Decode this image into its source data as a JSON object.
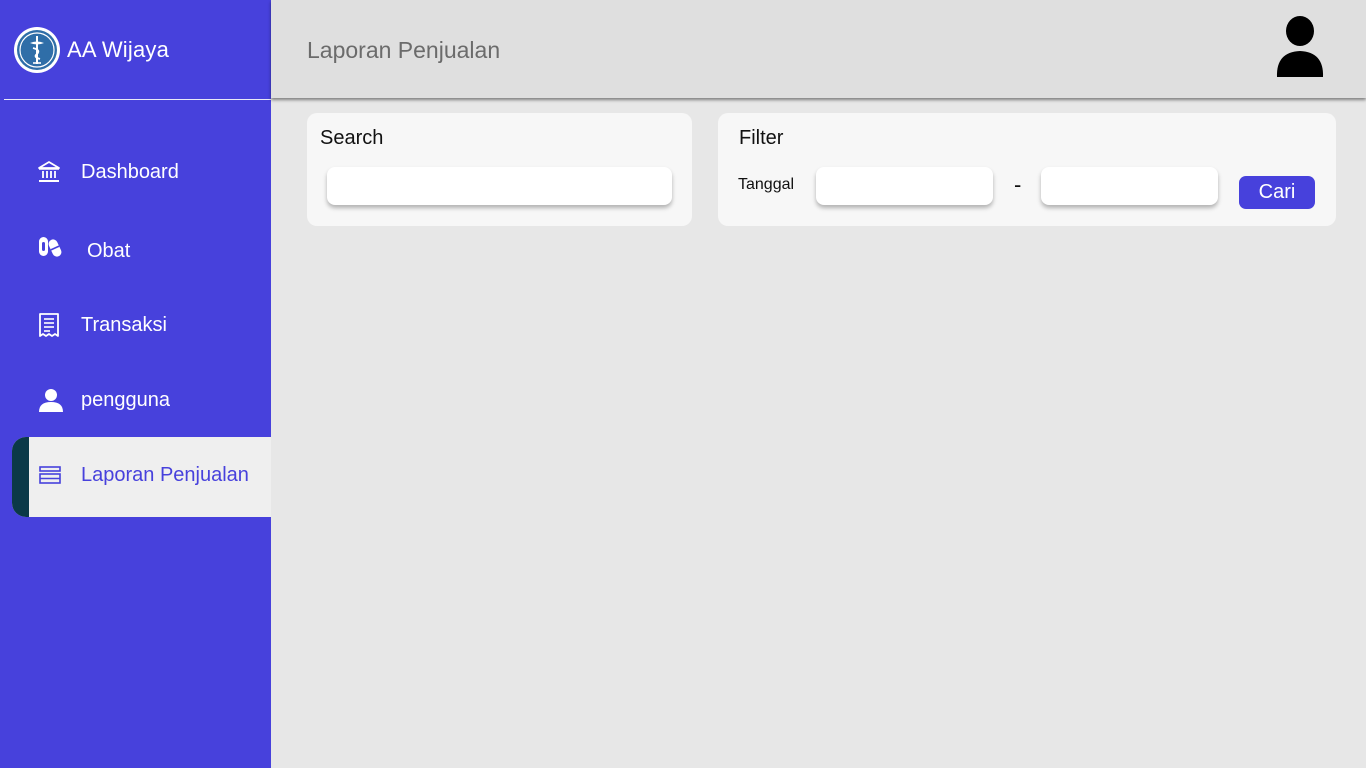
{
  "brand": {
    "name": "AA Wijaya",
    "logo_icon": "pharmacy-caduceus-logo"
  },
  "sidebar": {
    "items": [
      {
        "label": "Dashboard",
        "icon": "bank-icon"
      },
      {
        "label": "Obat",
        "icon": "pills-icon"
      },
      {
        "label": "Transaksi",
        "icon": "receipt-icon"
      },
      {
        "label": "pengguna",
        "icon": "user-icon"
      },
      {
        "label": "Laporan Penjualan",
        "icon": "report-icon",
        "active": true
      }
    ]
  },
  "header": {
    "title": "Laporan Penjualan",
    "avatar_icon": "user-avatar-icon"
  },
  "search": {
    "title": "Search",
    "value": ""
  },
  "filter": {
    "title": "Filter",
    "date_label": "Tanggal",
    "start_value": "",
    "end_value": "",
    "separator": "-",
    "button_label": "Cari"
  },
  "colors": {
    "primary": "#4741dc",
    "active_bar": "#0b3948",
    "background": "#e7e7e7",
    "header": "#dfdfdf",
    "card": "#f7f7f7"
  }
}
